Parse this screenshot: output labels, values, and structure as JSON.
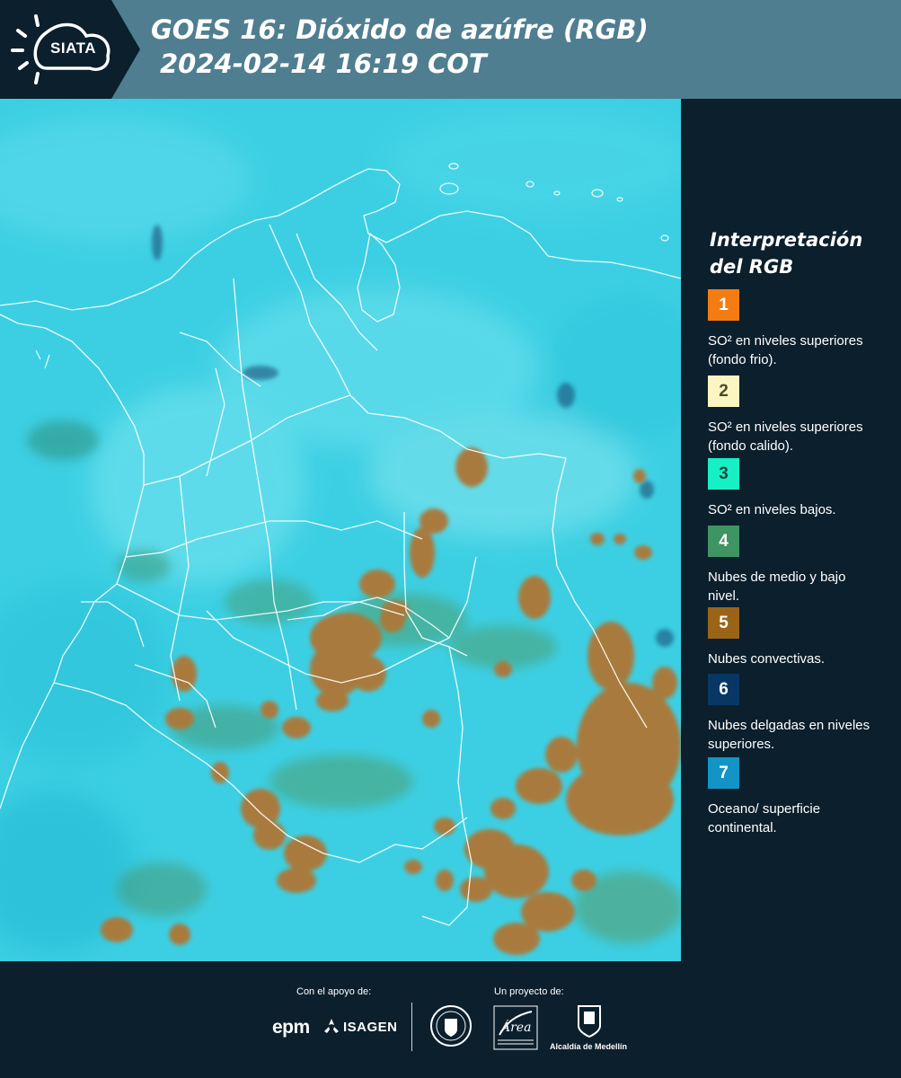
{
  "header": {
    "logo_text": "SIATA",
    "title_line1": "GOES 16: Dióxido de azúfre (RGB)",
    "title_line2": "2024-02-14 16:19 COT"
  },
  "legend": {
    "title": "Interpretación del RGB",
    "items": [
      {
        "number": "1",
        "color": "#f47c12",
        "text_color": "#ffffff",
        "label": "SO² en niveles superiores (fondo frio)."
      },
      {
        "number": "2",
        "color": "#fbf5c2",
        "text_color": "#4a4a30",
        "label": "SO² en niveles superiores (fondo calido)."
      },
      {
        "number": "3",
        "color": "#17f0c4",
        "text_color": "#1a4a40",
        "label": "SO² en niveles bajos."
      },
      {
        "number": "4",
        "color": "#3f9464",
        "text_color": "#ffffff",
        "label": "Nubes de medio y bajo nivel."
      },
      {
        "number": "5",
        "color": "#9a6418",
        "text_color": "#ffffff",
        "label": "Nubes convectivas."
      },
      {
        "number": "6",
        "color": "#083764",
        "text_color": "#ffffff",
        "label": "Nubes delgadas en niveles superiores."
      },
      {
        "number": "7",
        "color": "#1295c6",
        "text_color": "#ffffff",
        "label": "Oceano/ superficie continental."
      }
    ]
  },
  "map": {
    "background_color": "#3ccfe3",
    "cloud_color": "#a87a3c",
    "border_color": "#ffffff"
  },
  "footer": {
    "support_caption": "Con el apoyo de:",
    "project_caption": "Un proyecto de:",
    "epm_label": "epm",
    "isagen_label": "ISAGEN",
    "alcaldia_label": "Alcaldía de Medellín"
  }
}
